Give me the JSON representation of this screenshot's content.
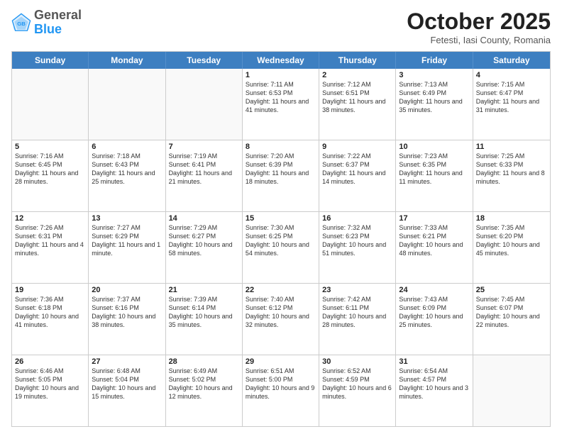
{
  "header": {
    "logo_general": "General",
    "logo_blue": "Blue",
    "month_title": "October 2025",
    "location": "Fetesti, Iasi County, Romania"
  },
  "days_of_week": [
    "Sunday",
    "Monday",
    "Tuesday",
    "Wednesday",
    "Thursday",
    "Friday",
    "Saturday"
  ],
  "weeks": [
    [
      {
        "day": "",
        "text": "",
        "empty": true
      },
      {
        "day": "",
        "text": "",
        "empty": true
      },
      {
        "day": "",
        "text": "",
        "empty": true
      },
      {
        "day": "1",
        "text": "Sunrise: 7:11 AM\nSunset: 6:53 PM\nDaylight: 11 hours and 41 minutes.",
        "empty": false
      },
      {
        "day": "2",
        "text": "Sunrise: 7:12 AM\nSunset: 6:51 PM\nDaylight: 11 hours and 38 minutes.",
        "empty": false
      },
      {
        "day": "3",
        "text": "Sunrise: 7:13 AM\nSunset: 6:49 PM\nDaylight: 11 hours and 35 minutes.",
        "empty": false
      },
      {
        "day": "4",
        "text": "Sunrise: 7:15 AM\nSunset: 6:47 PM\nDaylight: 11 hours and 31 minutes.",
        "empty": false
      }
    ],
    [
      {
        "day": "5",
        "text": "Sunrise: 7:16 AM\nSunset: 6:45 PM\nDaylight: 11 hours and 28 minutes.",
        "empty": false
      },
      {
        "day": "6",
        "text": "Sunrise: 7:18 AM\nSunset: 6:43 PM\nDaylight: 11 hours and 25 minutes.",
        "empty": false
      },
      {
        "day": "7",
        "text": "Sunrise: 7:19 AM\nSunset: 6:41 PM\nDaylight: 11 hours and 21 minutes.",
        "empty": false
      },
      {
        "day": "8",
        "text": "Sunrise: 7:20 AM\nSunset: 6:39 PM\nDaylight: 11 hours and 18 minutes.",
        "empty": false
      },
      {
        "day": "9",
        "text": "Sunrise: 7:22 AM\nSunset: 6:37 PM\nDaylight: 11 hours and 14 minutes.",
        "empty": false
      },
      {
        "day": "10",
        "text": "Sunrise: 7:23 AM\nSunset: 6:35 PM\nDaylight: 11 hours and 11 minutes.",
        "empty": false
      },
      {
        "day": "11",
        "text": "Sunrise: 7:25 AM\nSunset: 6:33 PM\nDaylight: 11 hours and 8 minutes.",
        "empty": false
      }
    ],
    [
      {
        "day": "12",
        "text": "Sunrise: 7:26 AM\nSunset: 6:31 PM\nDaylight: 11 hours and 4 minutes.",
        "empty": false
      },
      {
        "day": "13",
        "text": "Sunrise: 7:27 AM\nSunset: 6:29 PM\nDaylight: 11 hours and 1 minute.",
        "empty": false
      },
      {
        "day": "14",
        "text": "Sunrise: 7:29 AM\nSunset: 6:27 PM\nDaylight: 10 hours and 58 minutes.",
        "empty": false
      },
      {
        "day": "15",
        "text": "Sunrise: 7:30 AM\nSunset: 6:25 PM\nDaylight: 10 hours and 54 minutes.",
        "empty": false
      },
      {
        "day": "16",
        "text": "Sunrise: 7:32 AM\nSunset: 6:23 PM\nDaylight: 10 hours and 51 minutes.",
        "empty": false
      },
      {
        "day": "17",
        "text": "Sunrise: 7:33 AM\nSunset: 6:21 PM\nDaylight: 10 hours and 48 minutes.",
        "empty": false
      },
      {
        "day": "18",
        "text": "Sunrise: 7:35 AM\nSunset: 6:20 PM\nDaylight: 10 hours and 45 minutes.",
        "empty": false
      }
    ],
    [
      {
        "day": "19",
        "text": "Sunrise: 7:36 AM\nSunset: 6:18 PM\nDaylight: 10 hours and 41 minutes.",
        "empty": false
      },
      {
        "day": "20",
        "text": "Sunrise: 7:37 AM\nSunset: 6:16 PM\nDaylight: 10 hours and 38 minutes.",
        "empty": false
      },
      {
        "day": "21",
        "text": "Sunrise: 7:39 AM\nSunset: 6:14 PM\nDaylight: 10 hours and 35 minutes.",
        "empty": false
      },
      {
        "day": "22",
        "text": "Sunrise: 7:40 AM\nSunset: 6:12 PM\nDaylight: 10 hours and 32 minutes.",
        "empty": false
      },
      {
        "day": "23",
        "text": "Sunrise: 7:42 AM\nSunset: 6:11 PM\nDaylight: 10 hours and 28 minutes.",
        "empty": false
      },
      {
        "day": "24",
        "text": "Sunrise: 7:43 AM\nSunset: 6:09 PM\nDaylight: 10 hours and 25 minutes.",
        "empty": false
      },
      {
        "day": "25",
        "text": "Sunrise: 7:45 AM\nSunset: 6:07 PM\nDaylight: 10 hours and 22 minutes.",
        "empty": false
      }
    ],
    [
      {
        "day": "26",
        "text": "Sunrise: 6:46 AM\nSunset: 5:05 PM\nDaylight: 10 hours and 19 minutes.",
        "empty": false
      },
      {
        "day": "27",
        "text": "Sunrise: 6:48 AM\nSunset: 5:04 PM\nDaylight: 10 hours and 15 minutes.",
        "empty": false
      },
      {
        "day": "28",
        "text": "Sunrise: 6:49 AM\nSunset: 5:02 PM\nDaylight: 10 hours and 12 minutes.",
        "empty": false
      },
      {
        "day": "29",
        "text": "Sunrise: 6:51 AM\nSunset: 5:00 PM\nDaylight: 10 hours and 9 minutes.",
        "empty": false
      },
      {
        "day": "30",
        "text": "Sunrise: 6:52 AM\nSunset: 4:59 PM\nDaylight: 10 hours and 6 minutes.",
        "empty": false
      },
      {
        "day": "31",
        "text": "Sunrise: 6:54 AM\nSunset: 4:57 PM\nDaylight: 10 hours and 3 minutes.",
        "empty": false
      },
      {
        "day": "",
        "text": "",
        "empty": true
      }
    ]
  ]
}
